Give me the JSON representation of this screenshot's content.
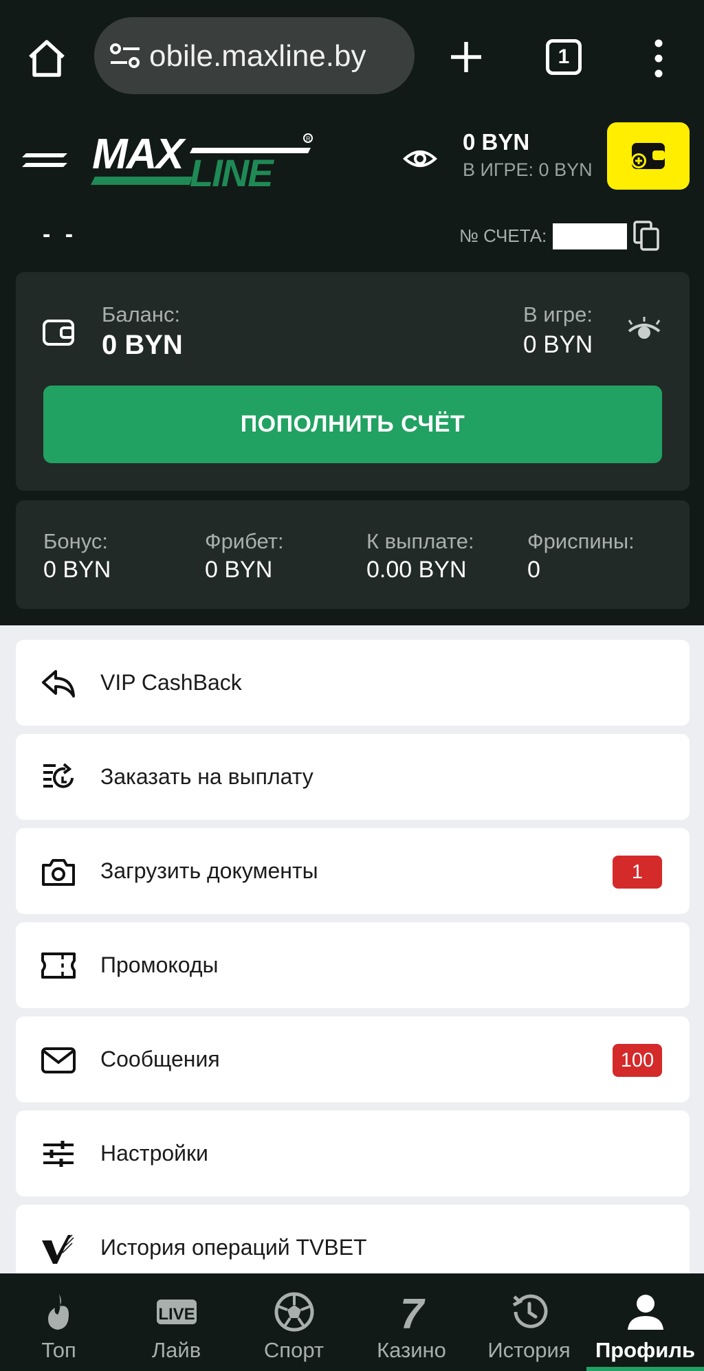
{
  "browser": {
    "url": "obile.maxline.by",
    "tab_count": "1"
  },
  "header": {
    "logo_text_max": "MAX",
    "logo_text_line": "LINE",
    "balance": "0 BYN",
    "in_game": "В ИГРЕ: 0 BYN"
  },
  "account": {
    "name": "- -",
    "number_label": "№ СЧЕТА:"
  },
  "balance_card": {
    "balance_label": "Баланс:",
    "balance_value": "0 BYN",
    "in_game_label": "В игре:",
    "in_game_value": "0 BYN",
    "topup_label": "ПОПОЛНИТЬ СЧЁТ"
  },
  "stats": [
    {
      "label": "Бонус:",
      "value": "0 BYN"
    },
    {
      "label": "Фрибет:",
      "value": "0 BYN"
    },
    {
      "label": "К выплате:",
      "value": "0.00 BYN"
    },
    {
      "label": "Фриспины:",
      "value": "0"
    }
  ],
  "menu": [
    {
      "label": "VIP CashBack",
      "icon": "reply-arrow-icon",
      "badge": ""
    },
    {
      "label": "Заказать на выплату",
      "icon": "payout-request-icon",
      "badge": ""
    },
    {
      "label": "Загрузить документы",
      "icon": "camera-icon",
      "badge": "1"
    },
    {
      "label": "Промокоды",
      "icon": "ticket-icon",
      "badge": ""
    },
    {
      "label": "Сообщения",
      "icon": "envelope-icon",
      "badge": "100"
    },
    {
      "label": "Настройки",
      "icon": "sliders-icon",
      "badge": ""
    },
    {
      "label": "История операций TVBET",
      "icon": "tvbet-logo-icon",
      "badge": ""
    }
  ],
  "bottom_nav": [
    {
      "label": "Топ",
      "icon": "flame-icon"
    },
    {
      "label": "Лайв",
      "icon": "live-icon",
      "icon_text": "LIVE"
    },
    {
      "label": "Спорт",
      "icon": "soccer-ball-icon"
    },
    {
      "label": "Казино",
      "icon": "seven-icon",
      "icon_text": "7"
    },
    {
      "label": "История",
      "icon": "history-clock-icon"
    },
    {
      "label": "Профиль",
      "icon": "user-icon",
      "active": true
    }
  ],
  "colors": {
    "dark_bg": "#121a17",
    "card_bg": "#222a27",
    "accent_green": "#21a262",
    "deposit_yellow": "#ffee00",
    "badge_red": "#d42a2a",
    "page_bg": "#eceef2"
  }
}
